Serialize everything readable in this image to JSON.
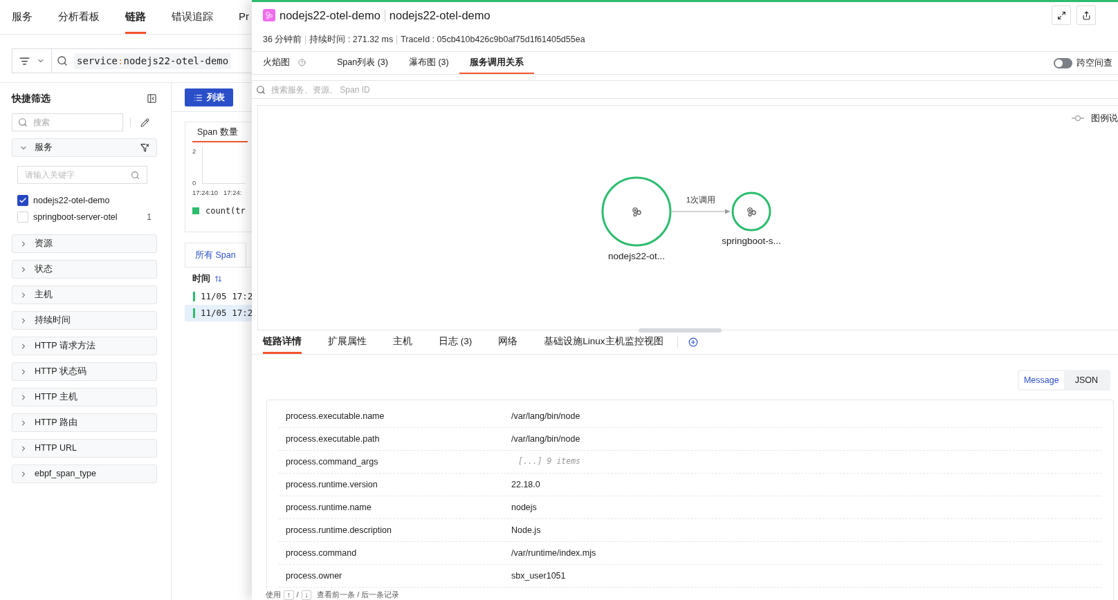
{
  "top_nav": [
    {
      "label": "服务",
      "selected": false
    },
    {
      "label": "分析看板",
      "selected": false
    },
    {
      "label": "链路",
      "selected": true
    },
    {
      "label": "错误追踪",
      "selected": false
    },
    {
      "label": "Pr",
      "selected": false
    }
  ],
  "query": {
    "parts": [
      {
        "kind": "key",
        "text": "service"
      },
      {
        "kind": "operator",
        "text": ":"
      },
      {
        "kind": "value",
        "text": "nodejs22-otel-demo"
      }
    ]
  },
  "quick_filter": {
    "title": "快捷筛选",
    "search_placeholder": "搜索",
    "groups": [
      {
        "label": "服务",
        "expanded": true,
        "keyword_placeholder": "请输入关键字",
        "options": [
          {
            "label": "nodejs22-otel-demo",
            "checked": true
          },
          {
            "label": "springboot-server-otel",
            "checked": false,
            "count": "1"
          }
        ]
      },
      {
        "label": "资源",
        "expanded": false
      },
      {
        "label": "状态",
        "expanded": false
      },
      {
        "label": "主机",
        "expanded": false
      },
      {
        "label": "持续时间",
        "expanded": false
      },
      {
        "label": "HTTP 请求方法",
        "expanded": false
      },
      {
        "label": "HTTP 状态码",
        "expanded": false
      },
      {
        "label": "HTTP 主机",
        "expanded": false
      },
      {
        "label": "HTTP 路由",
        "expanded": false
      },
      {
        "label": "HTTP URL",
        "expanded": false
      },
      {
        "label": "ebpf_span_type",
        "expanded": false
      }
    ]
  },
  "view_button": "列表",
  "chart_card": {
    "tab": "Span 数量",
    "y_ticks": [
      "2",
      "0"
    ],
    "x_ticks": [
      "17:24:10",
      "17:24:"
    ],
    "legend": "count(tr"
  },
  "span_tabs": [
    {
      "label": "所有 Span",
      "selected": true
    }
  ],
  "span_table": {
    "column": "时间",
    "rows": [
      {
        "time": "11/05 17:2",
        "selected": false
      },
      {
        "time": "11/05 17:2",
        "selected": true
      }
    ]
  },
  "drawer": {
    "service": "nodejs22-otel-demo",
    "resource": "nodejs22-otel-demo",
    "meta": [
      "36 分钟前",
      "持续时间 : 271.32 ms",
      "TraceId : 05cb410b426c9b0af75d1f61405d55ea"
    ],
    "tabs": [
      {
        "label": "火焰图",
        "selected": false,
        "help": true
      },
      {
        "label": "Span列表 (3)",
        "selected": false,
        "help": false
      },
      {
        "label": "瀑布图 (3)",
        "selected": false,
        "help": false
      },
      {
        "label": "服务调用关系",
        "selected": true,
        "help": false
      }
    ],
    "cross_space": {
      "label": "跨空间查",
      "on": false
    },
    "search_placeholder": "搜索服务、资源、 Span ID",
    "legend": "图例说",
    "graph": {
      "nodes": [
        {
          "label": "nodejs22-ot...",
          "kind": "root"
        },
        {
          "label": "springboot-s...",
          "kind": "child"
        }
      ],
      "edges": [
        {
          "label": "1次调用"
        }
      ]
    },
    "detail_tabs": [
      {
        "label": "链路详情",
        "selected": true
      },
      {
        "label": "扩展属性",
        "selected": false
      },
      {
        "label": "主机",
        "selected": false
      },
      {
        "label": "日志 (3)",
        "selected": false
      },
      {
        "label": "网络",
        "selected": false
      },
      {
        "label": "基础设施Linux主机监控视图",
        "selected": false
      }
    ],
    "view_toggle": [
      {
        "label": "Message",
        "selected": true
      },
      {
        "label": "JSON",
        "selected": false
      }
    ],
    "attributes": [
      {
        "key": "process.executable.name",
        "value": "/var/lang/bin/node",
        "kind": "text"
      },
      {
        "key": "process.executable.path",
        "value": "/var/lang/bin/node",
        "kind": "text"
      },
      {
        "key": "process.command_args",
        "value": "[...] 9 items",
        "kind": "collapsed"
      },
      {
        "key": "process.runtime.version",
        "value": "22.18.0",
        "kind": "text"
      },
      {
        "key": "process.runtime.name",
        "value": "nodejs",
        "kind": "text"
      },
      {
        "key": "process.runtime.description",
        "value": "Node.js",
        "kind": "text"
      },
      {
        "key": "process.command",
        "value": "/var/runtime/index.mjs",
        "kind": "text"
      },
      {
        "key": "process.owner",
        "value": "sbx_user1051",
        "kind": "text"
      }
    ],
    "footer": {
      "prefix": "使用",
      "keys": [
        "↑",
        "↓"
      ],
      "separator": "/",
      "suffix": "查看前一条 / 后一条记录"
    }
  }
}
